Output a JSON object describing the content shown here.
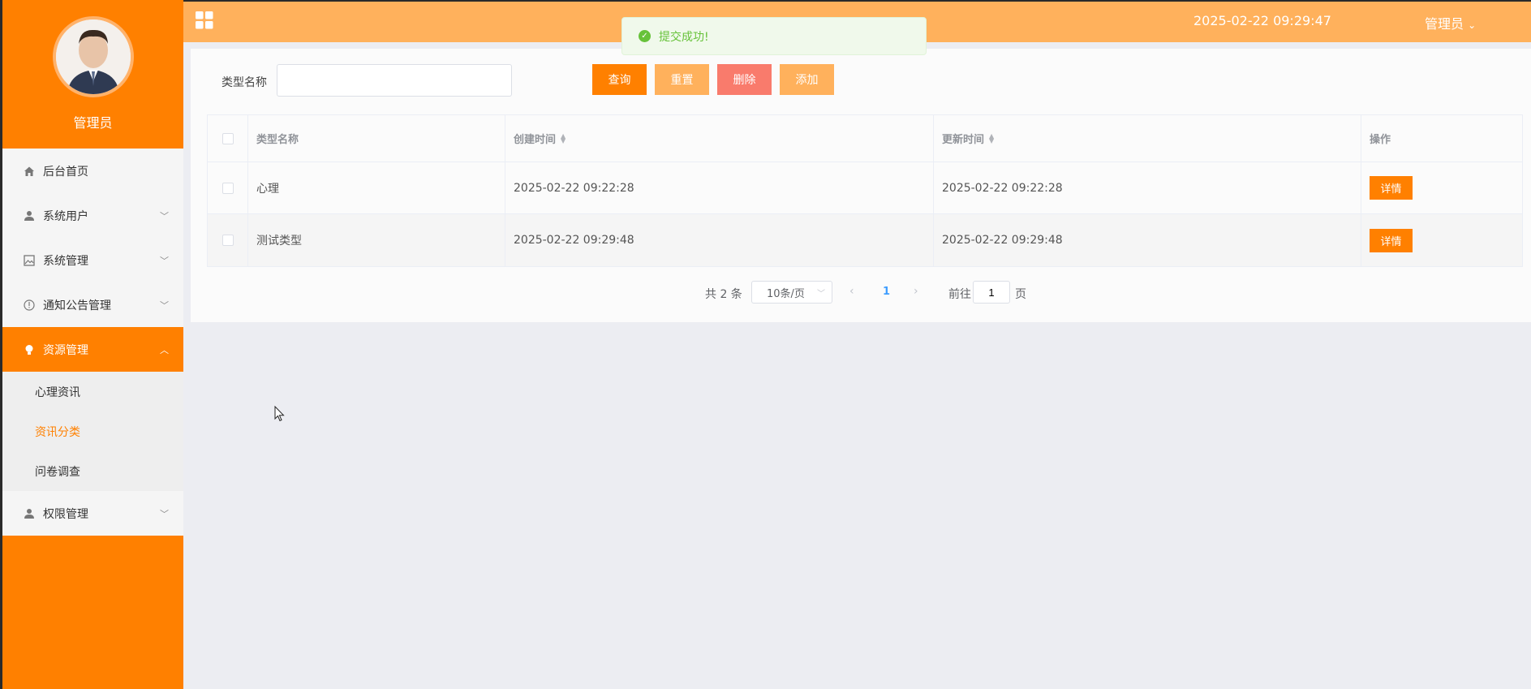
{
  "header": {
    "title": "",
    "datetime": "2025-02-22 09:29:47",
    "user": "管理员",
    "user_caret": "⌄"
  },
  "toast": {
    "message": "提交成功!"
  },
  "profile": {
    "name": "管理员"
  },
  "sidebar": {
    "items": [
      {
        "label": "后台首页"
      },
      {
        "label": "系统用户"
      },
      {
        "label": "系统管理"
      },
      {
        "label": "通知公告管理"
      },
      {
        "label": "资源管理"
      },
      {
        "label": "权限管理"
      }
    ],
    "submenu": [
      {
        "label": "心理资讯"
      },
      {
        "label": "资讯分类"
      },
      {
        "label": "问卷调查"
      }
    ]
  },
  "search": {
    "label": "类型名称",
    "value": "",
    "placeholder": ""
  },
  "toolbar": {
    "query": "查询",
    "reset": "重置",
    "delete": "删除",
    "add": "添加"
  },
  "table": {
    "columns": [
      "类型名称",
      "创建时间",
      "更新时间",
      "操作"
    ],
    "rows": [
      {
        "name": "心理",
        "created": "2025-02-22 09:22:28",
        "updated": "2025-02-22 09:22:28",
        "action": "详情"
      },
      {
        "name": "测试类型",
        "created": "2025-02-22 09:29:48",
        "updated": "2025-02-22 09:29:48",
        "action": "详情"
      }
    ]
  },
  "pagination": {
    "total": "共 2 条",
    "page_size": "10条/页",
    "current": "1",
    "goto_label": "前往",
    "goto_value": "1",
    "page_suffix": "页"
  },
  "colors": {
    "primary": "#ff8000",
    "header": "#ffb15c",
    "danger": "#f97b6c",
    "success": "#67c23a"
  }
}
